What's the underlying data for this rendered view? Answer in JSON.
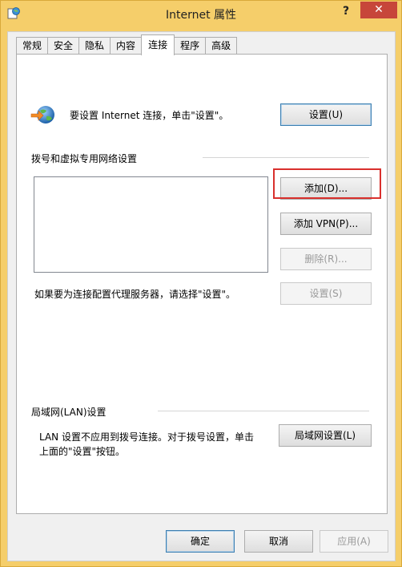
{
  "window": {
    "title": "Internet 属性",
    "help_label": "?",
    "close_label": "✕"
  },
  "tabs": [
    {
      "label": "常规"
    },
    {
      "label": "安全"
    },
    {
      "label": "隐私"
    },
    {
      "label": "内容"
    },
    {
      "label": "连接"
    },
    {
      "label": "程序"
    },
    {
      "label": "高级"
    }
  ],
  "setup": {
    "text": "要设置 Internet 连接，单击\"设置\"。",
    "button": "设置(U)"
  },
  "dialup": {
    "group_label": "拨号和虚拟专用网络设置",
    "add_button": "添加(D)...",
    "add_vpn_button": "添加 VPN(P)...",
    "remove_button": "删除(R)...",
    "settings_button": "设置(S)",
    "proxy_text": "如果要为连接配置代理服务器，请选择\"设置\"。"
  },
  "lan": {
    "group_label": "局域网(LAN)设置",
    "text_line1": "LAN 设置不应用到拨号连接。对于拨号设置，单击",
    "text_line2": "上面的\"设置\"按钮。",
    "button": "局域网设置(L)"
  },
  "footer": {
    "ok": "确定",
    "cancel": "取消",
    "apply": "应用(A)"
  },
  "colors": {
    "frame": "#f5ce6a",
    "close": "#c7463a",
    "highlight": "#d9302d"
  }
}
